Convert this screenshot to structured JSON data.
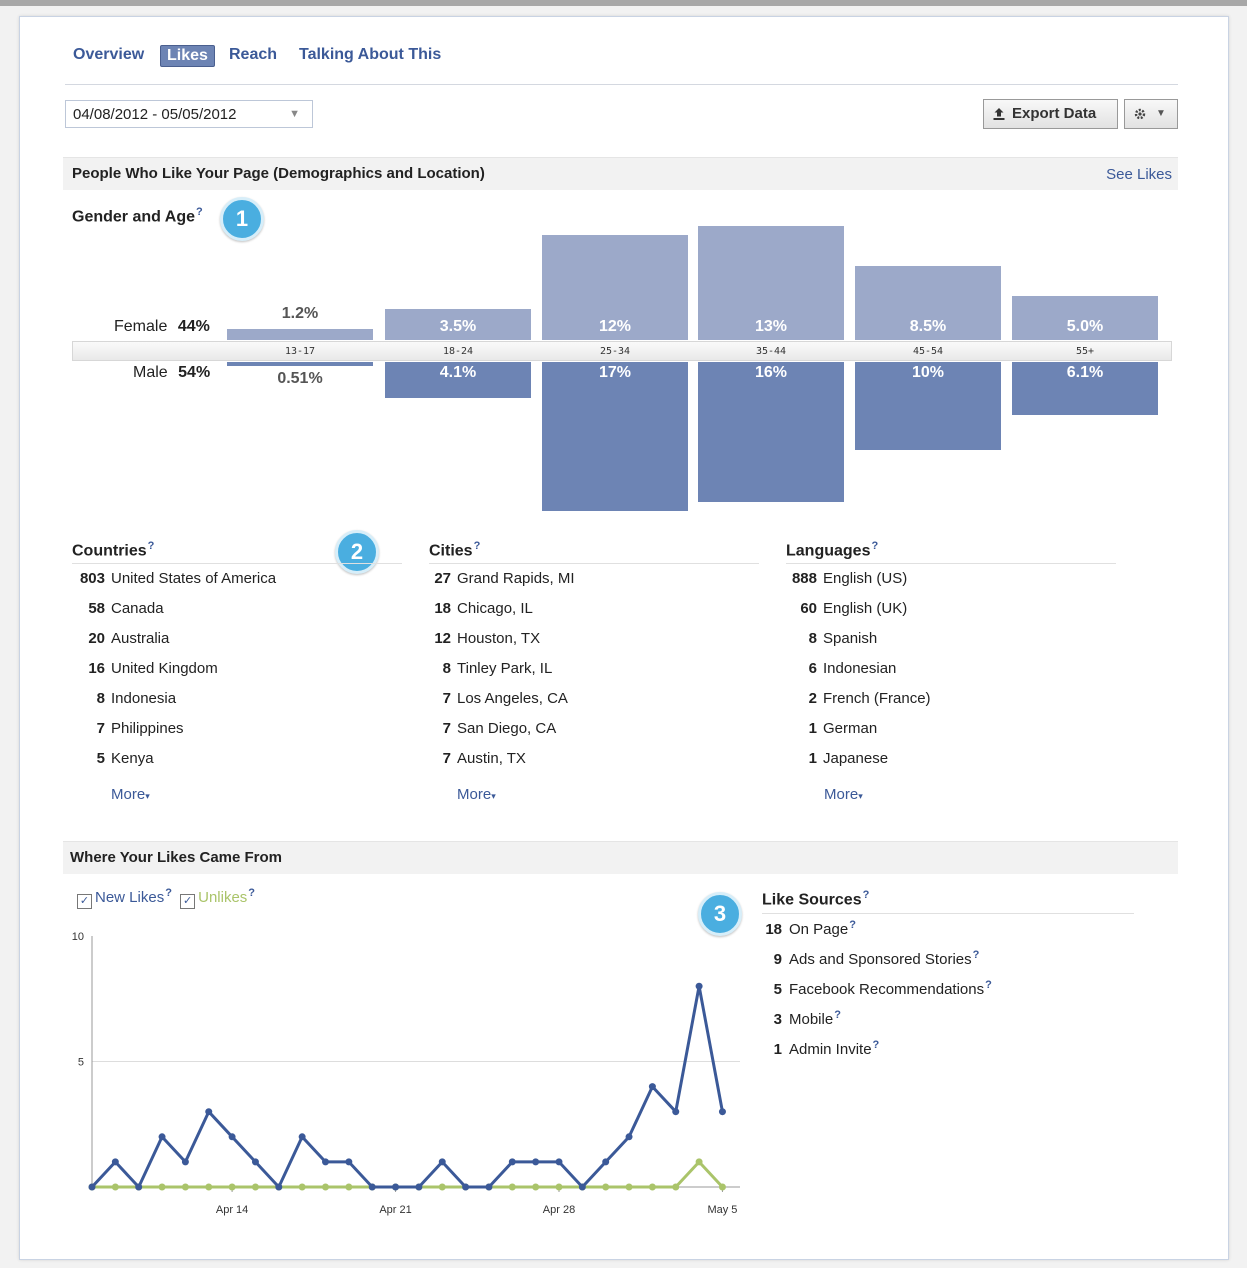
{
  "tabs": [
    {
      "label": "Overview",
      "active": false
    },
    {
      "label": "Likes",
      "active": true
    },
    {
      "label": "Reach",
      "active": false
    },
    {
      "label": "Talking About This",
      "active": false
    }
  ],
  "date_range": "04/08/2012 - 05/05/2012",
  "toolbar": {
    "export_label": "Export Data",
    "export_icon": "upload-icon",
    "settings_icon": "gear-icon"
  },
  "demographics": {
    "title": "People Who Like Your Page (Demographics and Location)",
    "see_likes": "See Likes",
    "gender_age_title": "Gender and Age",
    "female_label": "Female",
    "female_pct": "44%",
    "male_label": "Male",
    "male_pct": "54%"
  },
  "badges": [
    "1",
    "2",
    "3"
  ],
  "help_mark": "?",
  "chart_data": [
    {
      "type": "bar",
      "categories": [
        "13-17",
        "18-24",
        "25-34",
        "35-44",
        "45-54",
        "55+"
      ],
      "series": [
        {
          "name": "Female",
          "values": [
            1.2,
            3.5,
            12,
            13,
            8.5,
            5.0
          ],
          "labels": [
            "1.2%",
            "3.5%",
            "12%",
            "13%",
            "8.5%",
            "5.0%"
          ]
        },
        {
          "name": "Male",
          "values": [
            0.51,
            4.1,
            17,
            16,
            10,
            6.1
          ],
          "labels": [
            "0.51%",
            "4.1%",
            "17%",
            "16%",
            "10%",
            "6.1%"
          ]
        }
      ],
      "colors": {
        "female": "#9ca9c9",
        "male": "#6d84b4"
      }
    },
    {
      "type": "line",
      "x": [
        "Apr 8",
        "Apr 9",
        "Apr 10",
        "Apr 11",
        "Apr 12",
        "Apr 13",
        "Apr 14",
        "Apr 15",
        "Apr 16",
        "Apr 17",
        "Apr 18",
        "Apr 19",
        "Apr 20",
        "Apr 21",
        "Apr 22",
        "Apr 23",
        "Apr 24",
        "Apr 25",
        "Apr 26",
        "Apr 27",
        "Apr 28",
        "Apr 29",
        "Apr 30",
        "May 1",
        "May 2",
        "May 3",
        "May 4",
        "May 5"
      ],
      "x_ticks": [
        "Apr 14",
        "Apr 21",
        "Apr 28",
        "May 5"
      ],
      "y_ticks": [
        "10",
        "5"
      ],
      "ylim": [
        0,
        10
      ],
      "series": [
        {
          "name": "New Likes",
          "color": "#3b5998",
          "values": [
            0,
            1,
            0,
            2,
            1,
            3,
            2,
            1,
            0,
            2,
            1,
            1,
            0,
            0,
            0,
            1,
            0,
            0,
            1,
            1,
            1,
            0,
            1,
            2,
            4,
            3,
            8,
            3
          ]
        },
        {
          "name": "Unlikes",
          "color": "#aac46a",
          "values": [
            0,
            0,
            0,
            0,
            0,
            0,
            0,
            0,
            0,
            0,
            0,
            0,
            0,
            0,
            0,
            0,
            0,
            0,
            0,
            0,
            0,
            0,
            0,
            0,
            0,
            0,
            1,
            0
          ]
        }
      ]
    }
  ],
  "countries": {
    "title": "Countries",
    "items": [
      {
        "count": "803",
        "name": "United States of America"
      },
      {
        "count": "58",
        "name": "Canada"
      },
      {
        "count": "20",
        "name": "Australia"
      },
      {
        "count": "16",
        "name": "United Kingdom"
      },
      {
        "count": "8",
        "name": "Indonesia"
      },
      {
        "count": "7",
        "name": "Philippines"
      },
      {
        "count": "5",
        "name": "Kenya"
      }
    ],
    "more": "More"
  },
  "cities": {
    "title": "Cities",
    "items": [
      {
        "count": "27",
        "name": "Grand Rapids, MI"
      },
      {
        "count": "18",
        "name": "Chicago, IL"
      },
      {
        "count": "12",
        "name": "Houston, TX"
      },
      {
        "count": "8",
        "name": "Tinley Park, IL"
      },
      {
        "count": "7",
        "name": "Los Angeles, CA"
      },
      {
        "count": "7",
        "name": "San Diego, CA"
      },
      {
        "count": "7",
        "name": "Austin, TX"
      }
    ],
    "more": "More"
  },
  "languages": {
    "title": "Languages",
    "items": [
      {
        "count": "888",
        "name": "English (US)"
      },
      {
        "count": "60",
        "name": "English (UK)"
      },
      {
        "count": "8",
        "name": "Spanish"
      },
      {
        "count": "6",
        "name": "Indonesian"
      },
      {
        "count": "2",
        "name": "French (France)"
      },
      {
        "count": "1",
        "name": "German"
      },
      {
        "count": "1",
        "name": "Japanese"
      }
    ],
    "more": "More"
  },
  "likes_source": {
    "title": "Where Your Likes Came From",
    "new_likes_label": "New Likes",
    "unlikes_label": "Unlikes",
    "sources_title": "Like Sources",
    "sources": [
      {
        "count": "18",
        "name": "On Page"
      },
      {
        "count": "9",
        "name": "Ads and Sponsored Stories"
      },
      {
        "count": "5",
        "name": "Facebook Recommendations"
      },
      {
        "count": "3",
        "name": "Mobile"
      },
      {
        "count": "1",
        "name": "Admin Invite"
      }
    ]
  }
}
